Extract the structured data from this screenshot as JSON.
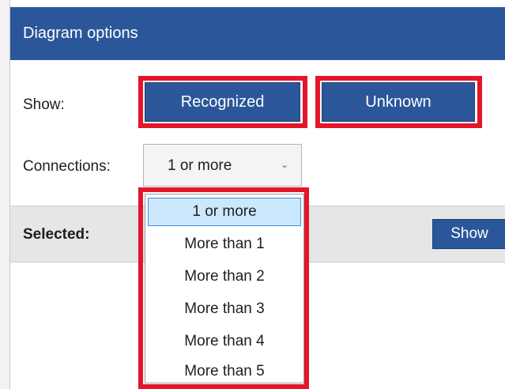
{
  "header": {
    "title": "Diagram options"
  },
  "show": {
    "label": "Show:",
    "buttons": [
      {
        "label": "Recognized"
      },
      {
        "label": "Unknown"
      }
    ]
  },
  "connections": {
    "label": "Connections:",
    "selected_value": "1 or more",
    "options": [
      "1 or more",
      "More than 1",
      "More than 2",
      "More than 3",
      "More than 4",
      "More than 5"
    ]
  },
  "selected_bar": {
    "label": "Selected:",
    "action_label": "Show"
  },
  "colors": {
    "header_blue": "#2b579a",
    "highlight_red": "#e3162a",
    "option_hover": "#cce8ff"
  }
}
